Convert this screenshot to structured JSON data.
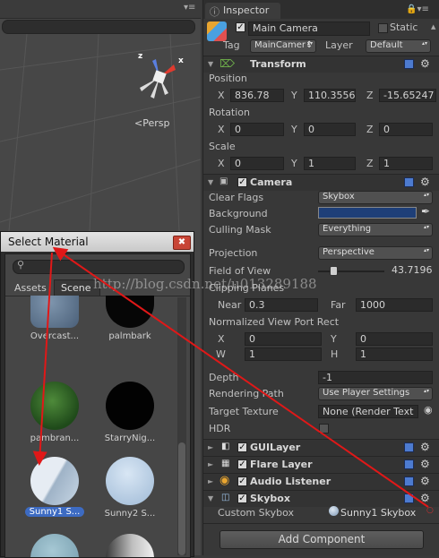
{
  "scene": {
    "projection_label": "Persp",
    "gizmo_axes": {
      "z": "z",
      "x": "x"
    }
  },
  "inspector": {
    "tab_label": "Inspector",
    "object_name": "Main Camera",
    "active": true,
    "static_label": "Static",
    "static_checked": false,
    "tag_label": "Tag",
    "tag_value": "MainCamer↕",
    "layer_label": "Layer",
    "layer_value": "Default",
    "transform": {
      "title": "Transform",
      "position_label": "Position",
      "position": {
        "x": "836.78",
        "y": "110.3556",
        "z": "-15.65247"
      },
      "rotation_label": "Rotation",
      "rotation": {
        "x": "0",
        "y": "0",
        "z": "0"
      },
      "scale_label": "Scale",
      "scale": {
        "x": "0",
        "y": "1",
        "z": "1"
      },
      "axis_x": "X",
      "axis_y": "Y",
      "axis_z": "Z"
    },
    "camera": {
      "title": "Camera",
      "enabled": true,
      "clear_flags_label": "Clear Flags",
      "clear_flags_value": "Skybox",
      "background_label": "Background",
      "background_color": "#1e3f78",
      "culling_mask_label": "Culling Mask",
      "culling_mask_value": "Everything",
      "projection_label": "Projection",
      "projection_value": "Perspective",
      "fov_label": "Field of View",
      "fov_value": "43.7196",
      "fov_slider_fraction": 0.23,
      "clipping_label": "Clipping Planes",
      "near_label": "Near",
      "near_value": "0.3",
      "far_label": "Far",
      "far_value": "1000",
      "viewport_label": "Normalized View Port Rect",
      "vp_x_label": "X",
      "vp_x": "0",
      "vp_y_label": "Y",
      "vp_y": "0",
      "vp_w_label": "W",
      "vp_w": "1",
      "vp_h_label": "H",
      "vp_h": "1",
      "depth_label": "Depth",
      "depth_value": "-1",
      "rendering_path_label": "Rendering Path",
      "rendering_path_value": "Use Player Settings",
      "target_texture_label": "Target Texture",
      "target_texture_value": "None (Render Text",
      "hdr_label": "HDR",
      "hdr_checked": false
    },
    "guilayer": {
      "title": "GUILayer",
      "enabled": true
    },
    "flarelayer": {
      "title": "Flare Layer",
      "enabled": true
    },
    "audiolistener": {
      "title": "Audio Listener",
      "enabled": true
    },
    "skybox": {
      "title": "Skybox",
      "enabled": true,
      "custom_label": "Custom Skybox",
      "custom_value": "Sunny1 Skybox"
    },
    "add_component_label": "Add Component"
  },
  "select_material": {
    "title": "Select Material",
    "tabs": [
      "Assets",
      "Scene"
    ],
    "items": [
      {
        "caption": "Overcast...",
        "kind": "overcast"
      },
      {
        "caption": "palmbark",
        "kind": "black"
      },
      {
        "caption": "pambran...",
        "kind": "leaf"
      },
      {
        "caption": "StarryNig...",
        "kind": "black"
      },
      {
        "caption": "Sunny1 S...",
        "kind": "sunny1",
        "selected": true
      },
      {
        "caption": "Sunny2 S...",
        "kind": "sunny2"
      },
      {
        "caption": "",
        "kind": "cyan"
      },
      {
        "caption": "",
        "kind": "silver"
      }
    ]
  },
  "watermark": "http://blog.csdn.net/u013289188",
  "colors": {
    "arrow": "#e01818",
    "selection": "#3d6bc2",
    "panel": "#383838"
  }
}
